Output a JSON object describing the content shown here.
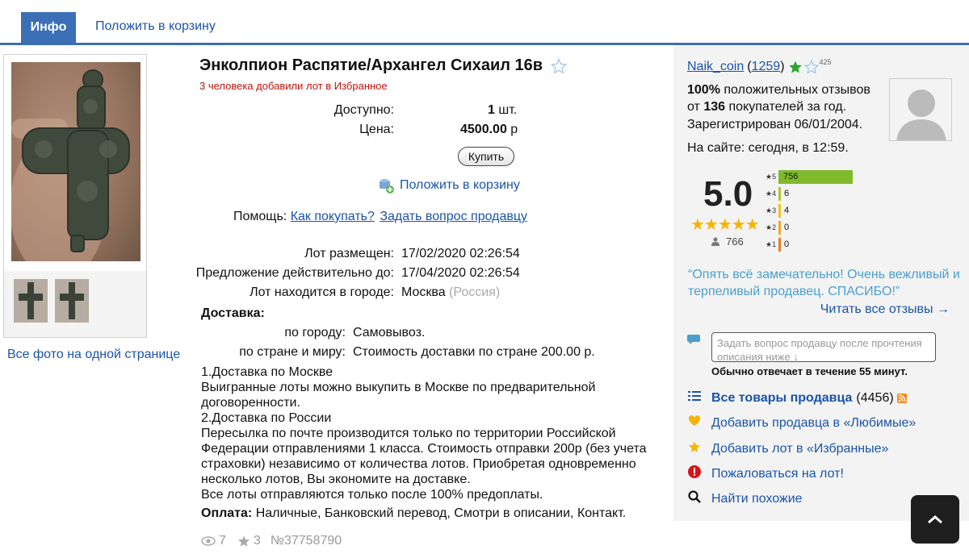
{
  "tabs": {
    "info": "Инфо",
    "cart": "Положить в корзину"
  },
  "gallery": {
    "all_photos": "Все фото на одной странице"
  },
  "lot": {
    "title": "Энколпион Распятие/Архангел Сихаил 16в",
    "fav_count": "3 человека добавили лот в Избранное",
    "available_label": "Доступно:",
    "available_qty": "1",
    "available_unit": "шт.",
    "price_label": "Цена:",
    "price_value": "4500.00",
    "price_currency": "р",
    "buy_button": "Купить",
    "add_to_cart": "Положить в корзину",
    "help_label": "Помощь:",
    "how_to_buy": "Как покупать?",
    "ask_seller": "Задать вопрос продавцу",
    "placed_label": "Лот размещен:",
    "placed_value": "17/02/2020 02:26:54",
    "valid_label": "Предложение действительно до:",
    "valid_value": "17/04/2020 02:26:54",
    "city_label": "Лот находится в городе:",
    "city_value": "Москва",
    "country_value": "(Россия)",
    "shipping_title": "Доставка:",
    "city_ship_label": "по городу:",
    "city_ship_value": "Самовывоз.",
    "country_ship_label": "по стране и миру:",
    "country_ship_value": "Стоимость доставки по стране 200.00 р.",
    "shipping_text": [
      "1.Доставка по Москве",
      "Выигранные лоты можно выкупить в Москве по предварительной договоренности.",
      "2.Доставка по России",
      "Пересылка по почте производится только по территории Российской Федерации отправлениями 1 класса. Стоимость отправки 200р (без учета страховки) независимо от количества лотов. Приобретая одновременно несколько лотов, Вы экономите на доставке.",
      "Все лоты отправляются только после 100% предоплаты."
    ],
    "payment_label": "Оплата:",
    "payment_value": "Наличные, Банковский перевод, Смотри в описании, Контакт.",
    "views": "7",
    "stars": "3",
    "lot_number": "№37758790"
  },
  "seller": {
    "name": "Naik_coin",
    "rating_open": "(",
    "rating": "1259",
    "rating_close": ")",
    "watchers": "425",
    "positive_pct": "100%",
    "positive_text": "положительных отзывов от",
    "buyers_count": "136",
    "buyers_text": "покупателей за год.",
    "registered": "Зарегистрирован 06/01/2004.",
    "online": "На сайте: сегодня, в 12:59.",
    "score": "5.0",
    "review_total": "766",
    "bars": [
      {
        "stars": "5",
        "count": "756",
        "fraction": 1.0,
        "color": "#7fba2c"
      },
      {
        "stars": "4",
        "count": "6",
        "fraction": 0.008,
        "color": "#a9c92a"
      },
      {
        "stars": "3",
        "count": "4",
        "fraction": 0.005,
        "color": "#f2c318"
      },
      {
        "stars": "2",
        "count": "0",
        "fraction": 0,
        "color": "#f5a623"
      },
      {
        "stars": "1",
        "count": "0",
        "fraction": 0,
        "color": "#f07b1c"
      }
    ],
    "quote": "“Опять всё замечательно! Очень вежливый и терпеливый продавец. СПАСИБО!”",
    "all_reviews": "Читать все отзывы →",
    "ask_placeholder": "Задать вопрос продавцу после прочтения описания ниже ↓",
    "reply_time": "Обычно отвечает в течение 55 минут.",
    "all_goods": "Все товары продавца",
    "all_goods_count": "(4456)",
    "add_fav_seller": "Добавить продавца в «Любимые»",
    "add_fav_lot": "Добавить лот в «Избранные»",
    "complain": "Пожаловаться на лот!",
    "find_similar": "Найти похожие"
  },
  "colors": {
    "accent": "#3b6fb6",
    "link": "#1a54a8",
    "quote": "#4a9fcd",
    "star": "#f5b400",
    "favred": "#c0140c"
  }
}
